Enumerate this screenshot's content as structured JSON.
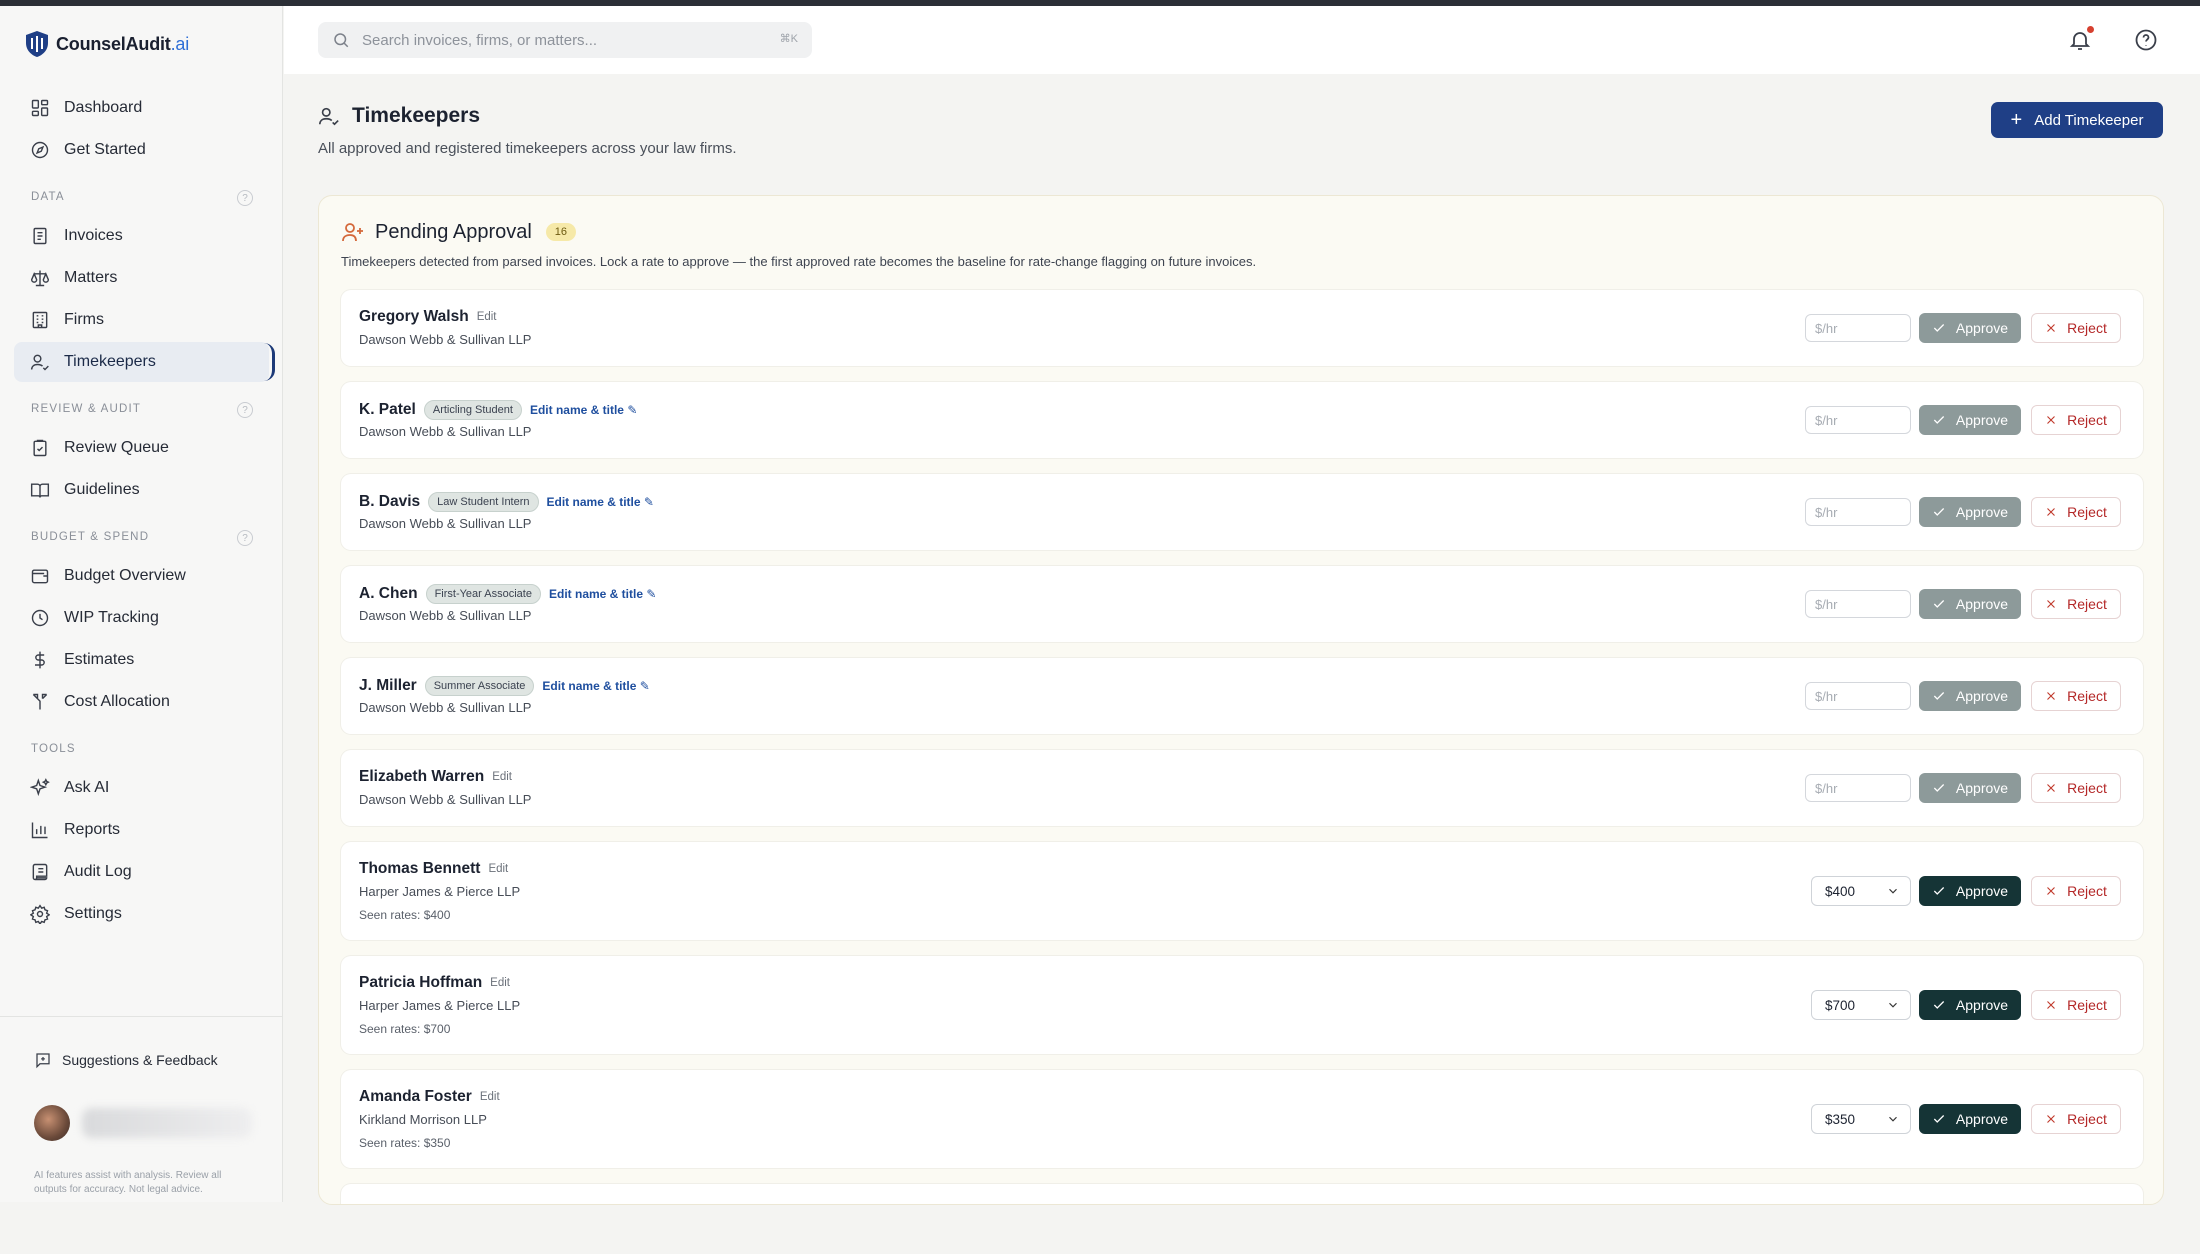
{
  "app": {
    "name": "CounselAudit",
    "name_suffix": ".ai"
  },
  "sidebar": {
    "items_top": [
      {
        "label": "Dashboard",
        "icon": "dashboard-icon"
      },
      {
        "label": "Get Started",
        "icon": "compass-icon"
      }
    ],
    "sections": [
      {
        "label": "DATA",
        "items": [
          {
            "label": "Invoices",
            "icon": "invoice-icon"
          },
          {
            "label": "Matters",
            "icon": "scale-icon"
          },
          {
            "label": "Firms",
            "icon": "building-icon"
          },
          {
            "label": "Timekeepers",
            "icon": "user-check-icon",
            "active": true
          }
        ]
      },
      {
        "label": "REVIEW & AUDIT",
        "items": [
          {
            "label": "Review Queue",
            "icon": "clipboard-icon"
          },
          {
            "label": "Guidelines",
            "icon": "book-icon"
          }
        ]
      },
      {
        "label": "BUDGET & SPEND",
        "items": [
          {
            "label": "Budget Overview",
            "icon": "wallet-icon"
          },
          {
            "label": "WIP Tracking",
            "icon": "clock-icon"
          },
          {
            "label": "Estimates",
            "icon": "dollar-icon"
          },
          {
            "label": "Cost Allocation",
            "icon": "split-icon"
          }
        ]
      },
      {
        "label": "TOOLS",
        "items": [
          {
            "label": "Ask AI",
            "icon": "sparkles-icon"
          },
          {
            "label": "Reports",
            "icon": "bar-chart-icon"
          },
          {
            "label": "Audit Log",
            "icon": "scroll-icon"
          },
          {
            "label": "Settings",
            "icon": "gear-icon"
          }
        ]
      }
    ],
    "feedback_label": "Suggestions & Feedback",
    "disclaimer": "AI features assist with analysis. Review all outputs for accuracy. Not legal advice."
  },
  "header": {
    "search_placeholder": "Search invoices, firms, or matters...",
    "shortcut": "⌘K"
  },
  "page": {
    "title": "Timekeepers",
    "subtitle": "All approved and registered timekeepers across your law firms.",
    "add_button": "Add Timekeeper"
  },
  "pending": {
    "title": "Pending Approval",
    "count": "16",
    "description": "Timekeepers detected from parsed invoices. Lock a rate to approve — the first approved rate becomes the baseline for rate-change flagging on future invoices.",
    "rate_placeholder": "$/hr",
    "approve_label": "Approve",
    "reject_label": "Reject",
    "rows": [
      {
        "name": "Gregory Walsh",
        "edit": "Edit",
        "firm": "Dawson Webb & Sullivan LLP"
      },
      {
        "name": "K. Patel",
        "title": "Articling Student",
        "edit_link": "Edit name & title ✎",
        "firm": "Dawson Webb & Sullivan LLP"
      },
      {
        "name": "B. Davis",
        "title": "Law Student Intern",
        "edit_link": "Edit name & title ✎",
        "firm": "Dawson Webb & Sullivan LLP"
      },
      {
        "name": "A. Chen",
        "title": "First-Year Associate",
        "edit_link": "Edit name & title ✎",
        "firm": "Dawson Webb & Sullivan LLP"
      },
      {
        "name": "J. Miller",
        "title": "Summer Associate",
        "edit_link": "Edit name & title ✎",
        "firm": "Dawson Webb & Sullivan LLP"
      },
      {
        "name": "Elizabeth Warren",
        "edit": "Edit",
        "firm": "Dawson Webb & Sullivan LLP"
      },
      {
        "name": "Thomas Bennett",
        "edit": "Edit",
        "firm": "Harper James & Pierce LLP",
        "seen": "Seen rates: $400",
        "rate": "$400"
      },
      {
        "name": "Patricia Hoffman",
        "edit": "Edit",
        "firm": "Harper James & Pierce LLP",
        "seen": "Seen rates: $700",
        "rate": "$700"
      },
      {
        "name": "Amanda Foster",
        "edit": "Edit",
        "firm": "Kirkland Morrison LLP",
        "seen": "Seen rates: $350",
        "rate": "$350"
      }
    ]
  }
}
